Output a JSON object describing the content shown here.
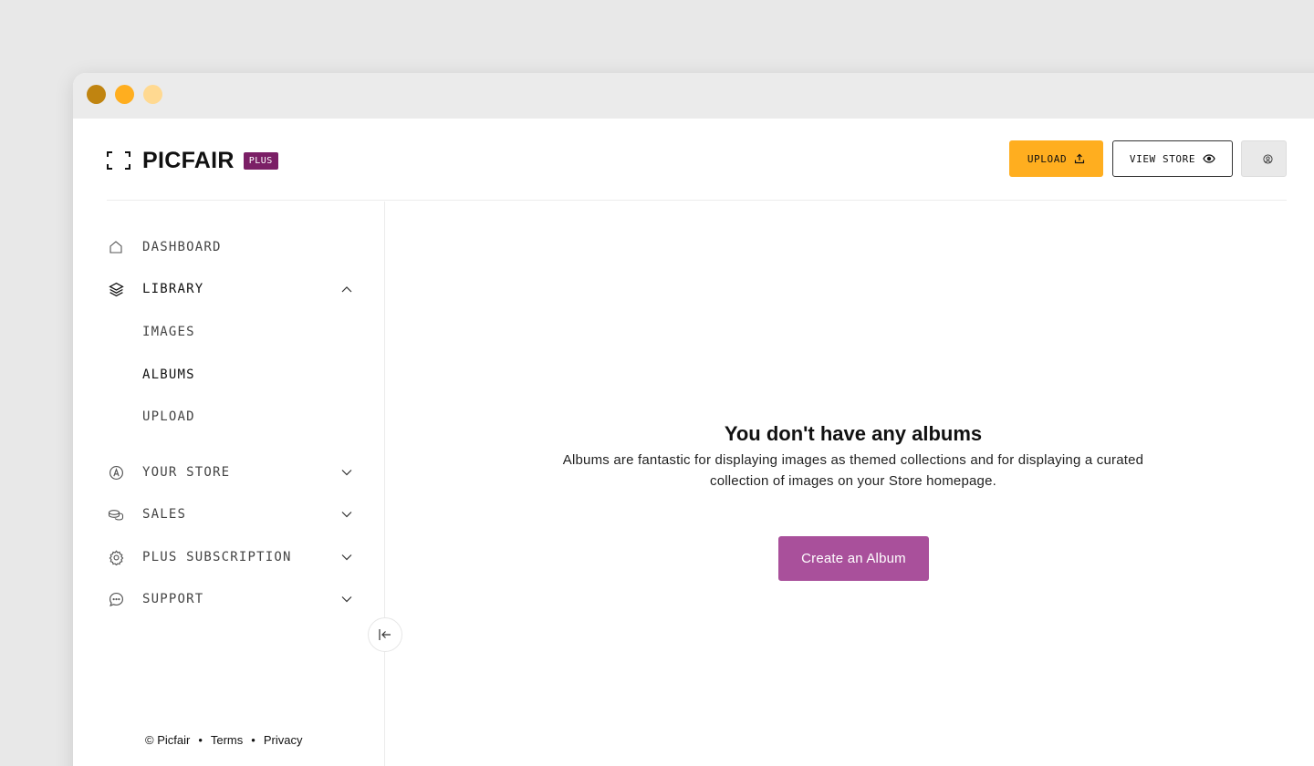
{
  "window": {
    "controls": [
      "close",
      "minimize",
      "maximize"
    ]
  },
  "header": {
    "logo_text": "PICFAIR",
    "plan_badge": "PLUS",
    "upload_label": "UPLOAD",
    "view_store_label": "VIEW STORE"
  },
  "sidebar": {
    "dashboard": "DASHBOARD",
    "library": "LIBRARY",
    "library_items": [
      "IMAGES",
      "ALBUMS",
      "UPLOAD"
    ],
    "active_item": "ALBUMS",
    "your_store": "YOUR STORE",
    "sales": "SALES",
    "plus_subscription": "PLUS SUBSCRIPTION",
    "support": "SUPPORT"
  },
  "footer": {
    "copyright": "© Picfair",
    "separator": "•",
    "terms": "Terms",
    "privacy": "Privacy"
  },
  "main": {
    "empty_title": "You don't have any albums",
    "empty_description": "Albums are fantastic for displaying images as themed collections and for displaying a curated collection of images on your Store homepage.",
    "create_button": "Create an Album"
  },
  "colors": {
    "accent_yellow": "#ffae1f",
    "brand_purple": "#7b1f66",
    "button_purple": "#a9509b"
  }
}
